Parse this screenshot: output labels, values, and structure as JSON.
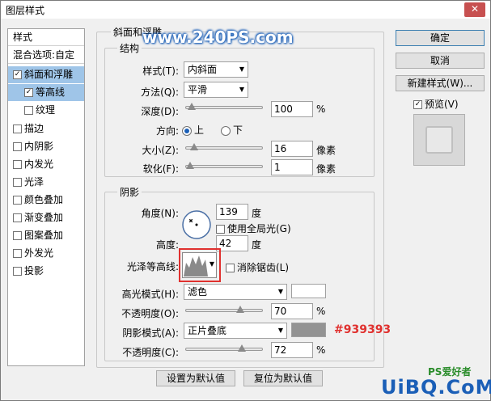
{
  "window": {
    "title": "图层样式",
    "close": "✕"
  },
  "sidebar": {
    "items": [
      {
        "label": "样式",
        "checked": null
      },
      {
        "label": "混合选项:自定",
        "checked": null
      },
      {
        "label": "斜面和浮雕",
        "checked": true
      },
      {
        "label": "等高线",
        "checked": true
      },
      {
        "label": "纹理",
        "checked": false
      },
      {
        "label": "描边",
        "checked": false
      },
      {
        "label": "内阴影",
        "checked": false
      },
      {
        "label": "内发光",
        "checked": false
      },
      {
        "label": "光泽",
        "checked": false
      },
      {
        "label": "颜色叠加",
        "checked": false
      },
      {
        "label": "渐变叠加",
        "checked": false
      },
      {
        "label": "图案叠加",
        "checked": false
      },
      {
        "label": "外发光",
        "checked": false
      },
      {
        "label": "投影",
        "checked": false
      }
    ]
  },
  "bevel": {
    "section_title": "斜面和浮雕",
    "structure_title": "结构",
    "style_label": "样式(T):",
    "style_value": "内斜面",
    "technique_label": "方法(Q):",
    "technique_value": "平滑",
    "depth_label": "深度(D):",
    "depth_value": "100",
    "depth_unit": "%",
    "direction_label": "方向:",
    "dir_up": "上",
    "dir_down": "下",
    "size_label": "大小(Z):",
    "size_value": "16",
    "size_unit": "像素",
    "soften_label": "软化(F):",
    "soften_value": "1",
    "soften_unit": "像素"
  },
  "shading": {
    "title": "阴影",
    "angle_label": "角度(N):",
    "angle_value": "139",
    "angle_unit": "度",
    "global_light_label": "使用全局光(G)",
    "altitude_label": "高度:",
    "altitude_value": "42",
    "altitude_unit": "度",
    "gloss_label": "光泽等高线:",
    "antialias_label": "消除锯齿(L)",
    "highlight_label": "高光模式(H):",
    "highlight_value": "滤色",
    "highlight_color": "#ffffff",
    "hl_opacity_label": "不透明度(O):",
    "hl_opacity_value": "70",
    "hl_opacity_unit": "%",
    "shadow_label": "阴影模式(A):",
    "shadow_value": "正片叠底",
    "shadow_color": "#939393",
    "sh_opacity_label": "不透明度(C):",
    "sh_opacity_value": "72",
    "sh_opacity_unit": "%",
    "color_annotation": "#939393"
  },
  "buttons": {
    "ok": "确定",
    "cancel": "取消",
    "new_style": "新建样式(W)...",
    "preview": "预览(V)",
    "make_default": "设置为默认值",
    "reset_default": "复位为默认值"
  },
  "watermark": "www.240PS.com",
  "logo_text": "UiBQ.CoM",
  "logo_ps": "PS爱好者",
  "colors": {
    "accent": "#1b5fb7",
    "selection": "#9fc5e8",
    "highlight_red": "#e0312f"
  }
}
